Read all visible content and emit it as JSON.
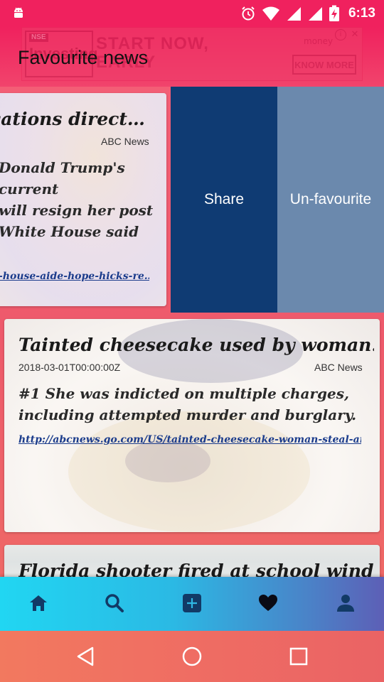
{
  "status_bar": {
    "time": "6:13",
    "icons": [
      "android-icon",
      "alarm-icon",
      "wifi-icon",
      "signal-icon",
      "signal-icon-2",
      "battery-charging-icon"
    ]
  },
  "ad": {
    "logo_tag": "NSE",
    "logo_text": "Investing",
    "headline": "START NOW, EARLY",
    "brand": "money",
    "cta": "KNOW MORE",
    "close": "✕",
    "info": "i"
  },
  "header": {
    "title": "Favourite news"
  },
  "swipe_actions": {
    "share": "Share",
    "unfavourite": "Un-favourite"
  },
  "articles": [
    {
      "headline": "cations direct…",
      "source": "ABC News",
      "snippet": "Donald Trump's\ncurrent\nwill resign her post\nWhite House said",
      "link": "-house-aide-hope-hicks-re…"
    },
    {
      "headline": "Tainted cheesecake used by woman…",
      "date": "2018-03-01T00:00:00Z",
      "source": "ABC News",
      "snippet": "#1 She was indicted on multiple charges, including attempted murder and burglary.",
      "link": "http://abcnews.go.com/US/tainted-cheesecake-woman-steal-an…"
    },
    {
      "headline": "Florida shooter fired at school wind"
    }
  ],
  "bottom_nav": {
    "items": [
      "home-icon",
      "search-icon",
      "add-icon",
      "heart-icon",
      "profile-icon"
    ],
    "active": "heart-icon"
  },
  "system_nav": {
    "items": [
      "back-icon",
      "home-circle-icon",
      "recents-icon"
    ]
  },
  "colors": {
    "status_bar": "#f0215e",
    "share_action": "#0f3b73",
    "unfavourite_action": "#6b89ad",
    "link": "#1b3c8c"
  }
}
